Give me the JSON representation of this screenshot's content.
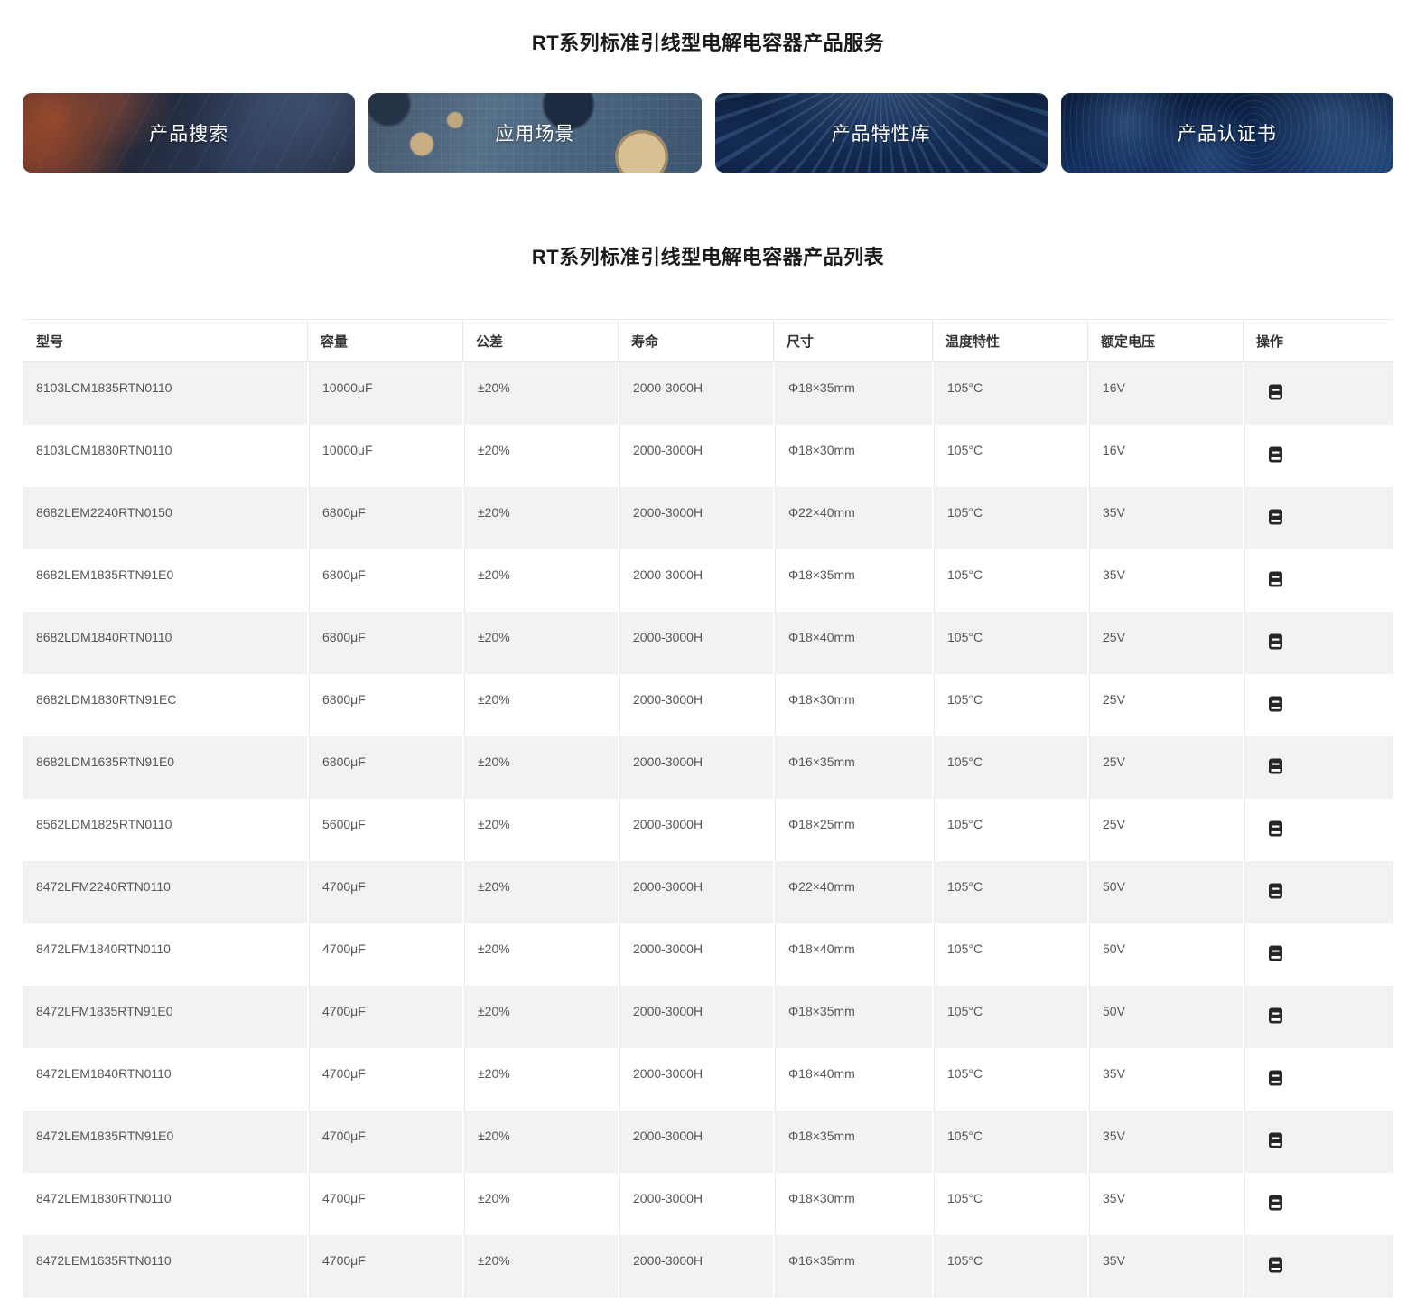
{
  "page": {
    "service_title": "RT系列标准引线型电解电容器产品服务",
    "list_title": "RT系列标准引线型电解电容器产品列表"
  },
  "nav_cards": [
    {
      "id": "product-search",
      "label": "产品搜索"
    },
    {
      "id": "application-scene",
      "label": "应用场景"
    },
    {
      "id": "feature-library",
      "label": "产品特性库"
    },
    {
      "id": "certificates",
      "label": "产品认证书"
    }
  ],
  "table": {
    "columns": [
      "型号",
      "容量",
      "公差",
      "寿命",
      "尺寸",
      "温度特性",
      "额定电压",
      "操作"
    ],
    "action_icon": "notebook-icon",
    "rows": [
      [
        "8103LCM1835RTN0110",
        "10000μF",
        "±20%",
        "2000-3000H",
        "Φ18×35mm",
        "105°C",
        "16V"
      ],
      [
        "8103LCM1830RTN0110",
        "10000μF",
        "±20%",
        "2000-3000H",
        "Φ18×30mm",
        "105°C",
        "16V"
      ],
      [
        "8682LEM2240RTN0150",
        "6800μF",
        "±20%",
        "2000-3000H",
        "Φ22×40mm",
        "105°C",
        "35V"
      ],
      [
        "8682LEM1835RTN91E0",
        "6800μF",
        "±20%",
        "2000-3000H",
        "Φ18×35mm",
        "105°C",
        "35V"
      ],
      [
        "8682LDM1840RTN0110",
        "6800μF",
        "±20%",
        "2000-3000H",
        "Φ18×40mm",
        "105°C",
        "25V"
      ],
      [
        "8682LDM1830RTN91EC",
        "6800μF",
        "±20%",
        "2000-3000H",
        "Φ18×30mm",
        "105°C",
        "25V"
      ],
      [
        "8682LDM1635RTN91E0",
        "6800μF",
        "±20%",
        "2000-3000H",
        "Φ16×35mm",
        "105°C",
        "25V"
      ],
      [
        "8562LDM1825RTN0110",
        "5600μF",
        "±20%",
        "2000-3000H",
        "Φ18×25mm",
        "105°C",
        "25V"
      ],
      [
        "8472LFM2240RTN0110",
        "4700μF",
        "±20%",
        "2000-3000H",
        "Φ22×40mm",
        "105°C",
        "50V"
      ],
      [
        "8472LFM1840RTN0110",
        "4700μF",
        "±20%",
        "2000-3000H",
        "Φ18×40mm",
        "105°C",
        "50V"
      ],
      [
        "8472LFM1835RTN91E0",
        "4700μF",
        "±20%",
        "2000-3000H",
        "Φ18×35mm",
        "105°C",
        "50V"
      ],
      [
        "8472LEM1840RTN0110",
        "4700μF",
        "±20%",
        "2000-3000H",
        "Φ18×40mm",
        "105°C",
        "35V"
      ],
      [
        "8472LEM1835RTN91E0",
        "4700μF",
        "±20%",
        "2000-3000H",
        "Φ18×35mm",
        "105°C",
        "35V"
      ],
      [
        "8472LEM1830RTN0110",
        "4700μF",
        "±20%",
        "2000-3000H",
        "Φ18×30mm",
        "105°C",
        "35V"
      ],
      [
        "8472LEM1635RTN0110",
        "4700μF",
        "±20%",
        "2000-3000H",
        "Φ16×35mm",
        "105°C",
        "35V"
      ]
    ]
  },
  "colors": {
    "stripe_row": "#f1f2f3",
    "table_border": "#e8e9eb",
    "heading_text": "#1a1a1a",
    "cell_text": "#565656",
    "card_text": "#ffffff",
    "action_icon": "#262626"
  }
}
